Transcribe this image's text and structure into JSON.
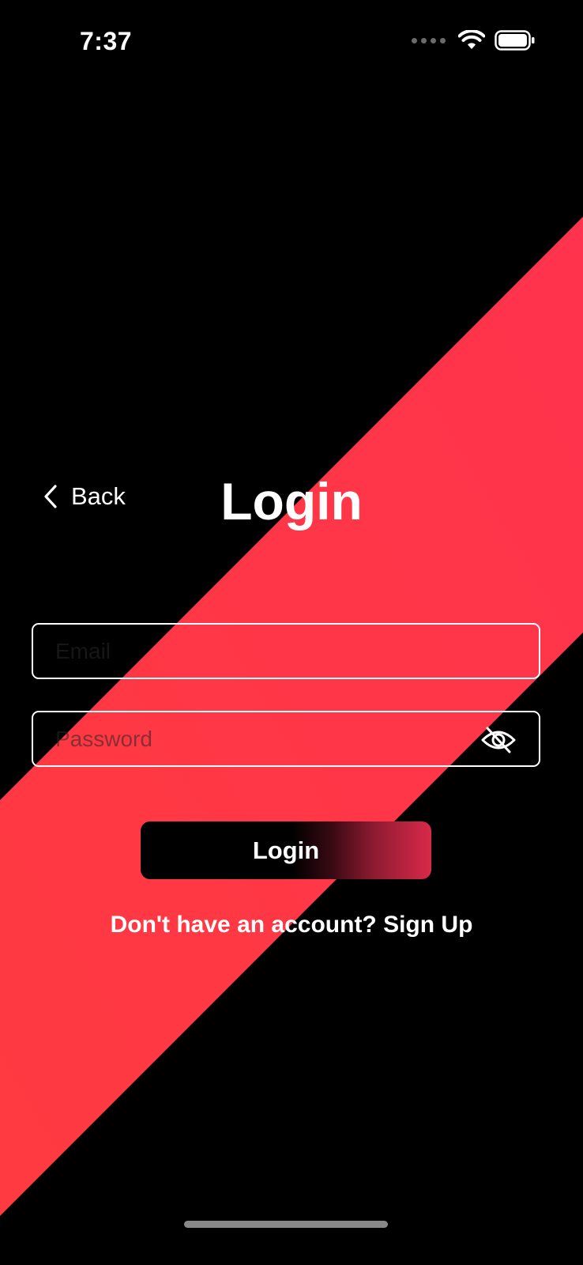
{
  "colors": {
    "background": "#000000",
    "stripe": "#FF3448",
    "text": "#FFFFFF",
    "button_gradient_end": "#D9294A"
  },
  "status_bar": {
    "time": "7:37",
    "icons": [
      "cellular-dots-icon",
      "wifi-icon",
      "battery-icon"
    ]
  },
  "nav": {
    "back_label": "Back",
    "back_icon": "chevron-left-icon",
    "title": "Login"
  },
  "form": {
    "email": {
      "placeholder": "Email",
      "value": ""
    },
    "password": {
      "placeholder": "Password",
      "value": "",
      "toggle_icon": "eye-slash-icon"
    },
    "submit_label": "Login",
    "signup_text": "Don't have an account? Sign Up"
  }
}
